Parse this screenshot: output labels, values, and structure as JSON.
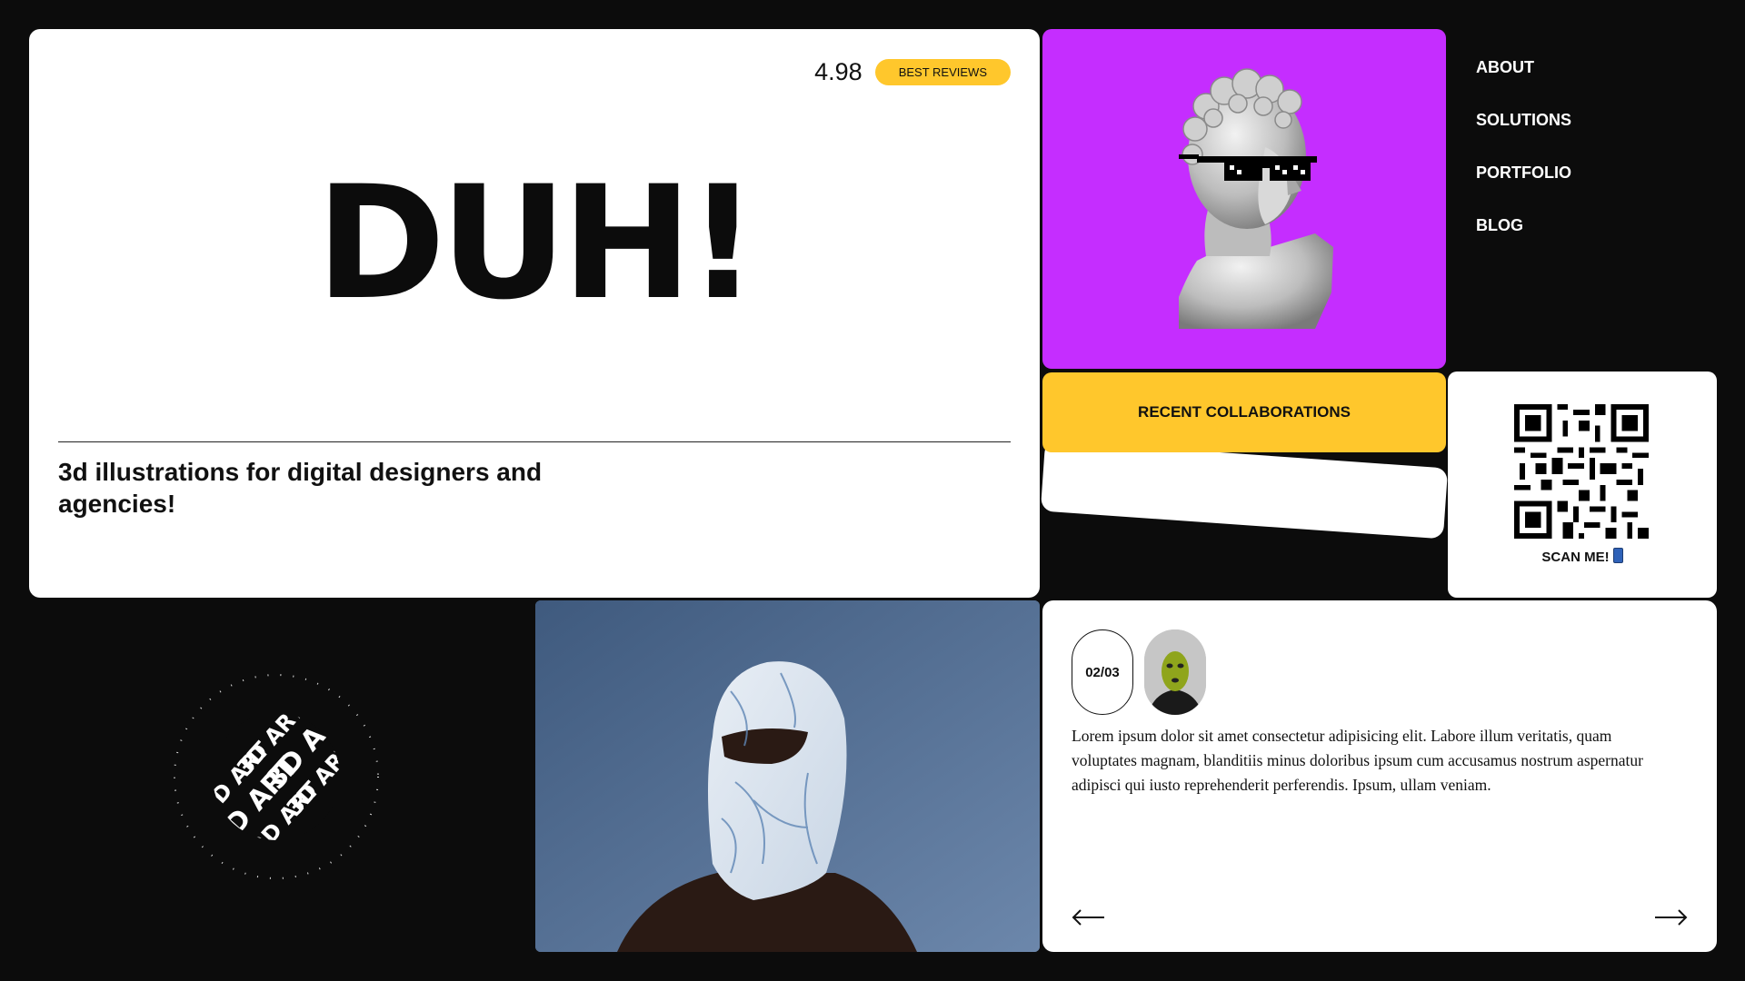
{
  "hero": {
    "rating": "4.98",
    "badge": "BEST REVIEWS",
    "title": "DUH!",
    "subtitle": "3d illustrations for digital designers and agencies!"
  },
  "nav": {
    "items": [
      {
        "label": "ABOUT"
      },
      {
        "label": "SOLUTIONS"
      },
      {
        "label": "PORTFOLIO"
      },
      {
        "label": "BLOG"
      }
    ]
  },
  "collaborations": {
    "label": "RECENT COLLABORATIONS"
  },
  "qr": {
    "label": "SCAN ME!",
    "icon": "phone-icon"
  },
  "sphere": {
    "text": "3D ART"
  },
  "testimonial": {
    "counter": "02/03",
    "text": "Lorem ipsum dolor sit amet consectetur adipisicing elit. Labore illum veritatis, quam voluptates magnam, blanditiis minus doloribus ipsum cum accusamus nostrum aspernatur adipisci qui iusto reprehenderit perferendis. Ipsum, ullam veniam.",
    "prev_icon": "arrow-left-icon",
    "next_icon": "arrow-right-icon"
  },
  "colors": {
    "background": "#0c0c0c",
    "accent_yellow": "#ffc72c",
    "accent_purple": "#c52dff",
    "card": "#ffffff"
  }
}
